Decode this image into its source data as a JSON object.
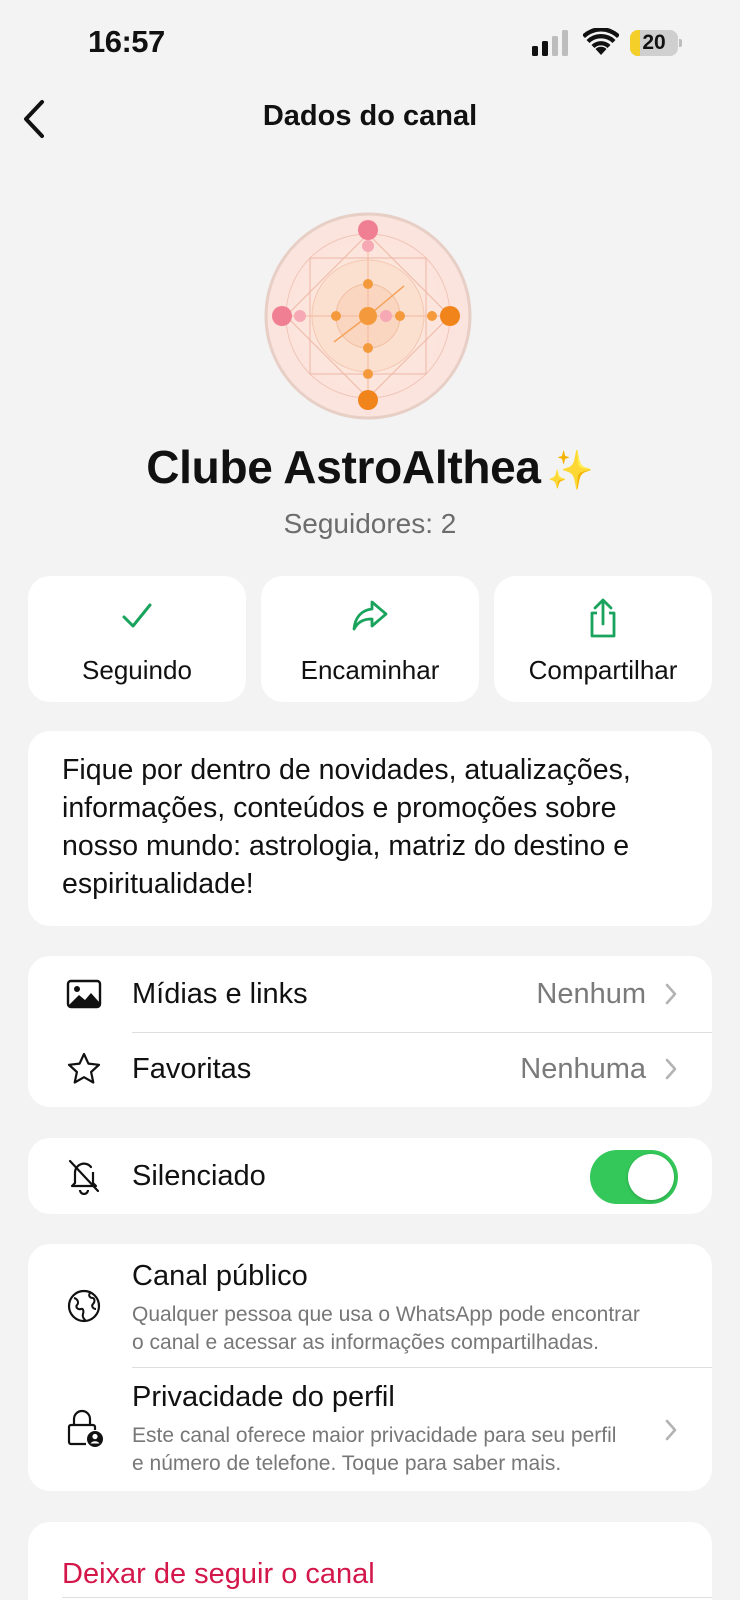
{
  "status_bar": {
    "time": "16:57",
    "battery_level": "20",
    "battery_fraction": 0.2,
    "battery_color": "#f4cf2a"
  },
  "nav": {
    "title": "Dados do canal",
    "back_icon": "chevron-left-icon"
  },
  "channel": {
    "name": "Clube AstroAlthea",
    "name_emoji": "✨",
    "followers": "Seguidores: 2",
    "avatar_icon": "astrology-chart-avatar"
  },
  "actions": [
    {
      "label": "Seguindo",
      "icon": "checkmark-icon"
    },
    {
      "label": "Encaminhar",
      "icon": "forward-arrow-icon"
    },
    {
      "label": "Compartilhar",
      "icon": "share-icon"
    }
  ],
  "description": "Fique por dentro de novidades, atualizações, informações, conteúdos e promoções sobre nosso mundo: astrologia, matriz do destino e espiritualidade!",
  "media_section": {
    "media": {
      "label": "Mídias e links",
      "value": "Nenhum",
      "icon": "image-icon"
    },
    "favorites": {
      "label": "Favoritas",
      "value": "Nenhuma",
      "icon": "star-icon"
    }
  },
  "mute": {
    "label": "Silenciado",
    "icon": "bell-slash-icon",
    "enabled": true
  },
  "privacy_section": {
    "public": {
      "title": "Canal público",
      "subtitle_line1": "Qualquer pessoa que usa o WhatsApp pode encontrar",
      "subtitle_line2": "o canal e acessar as informações compartilhadas.",
      "icon": "globe-icon"
    },
    "profile_privacy": {
      "title": "Privacidade do perfil",
      "subtitle_line1": "Este canal oferece maior privacidade para seu perfil",
      "subtitle_line2": "e número de telefone. Toque para saber mais.",
      "icon": "lock-person-icon"
    }
  },
  "unfollow": {
    "label": "Deixar de seguir o canal"
  },
  "colors": {
    "accent_green": "#1aa35c",
    "toggle_green": "#34c759",
    "danger_red": "#d4174a",
    "background": "#f3f3f3"
  }
}
